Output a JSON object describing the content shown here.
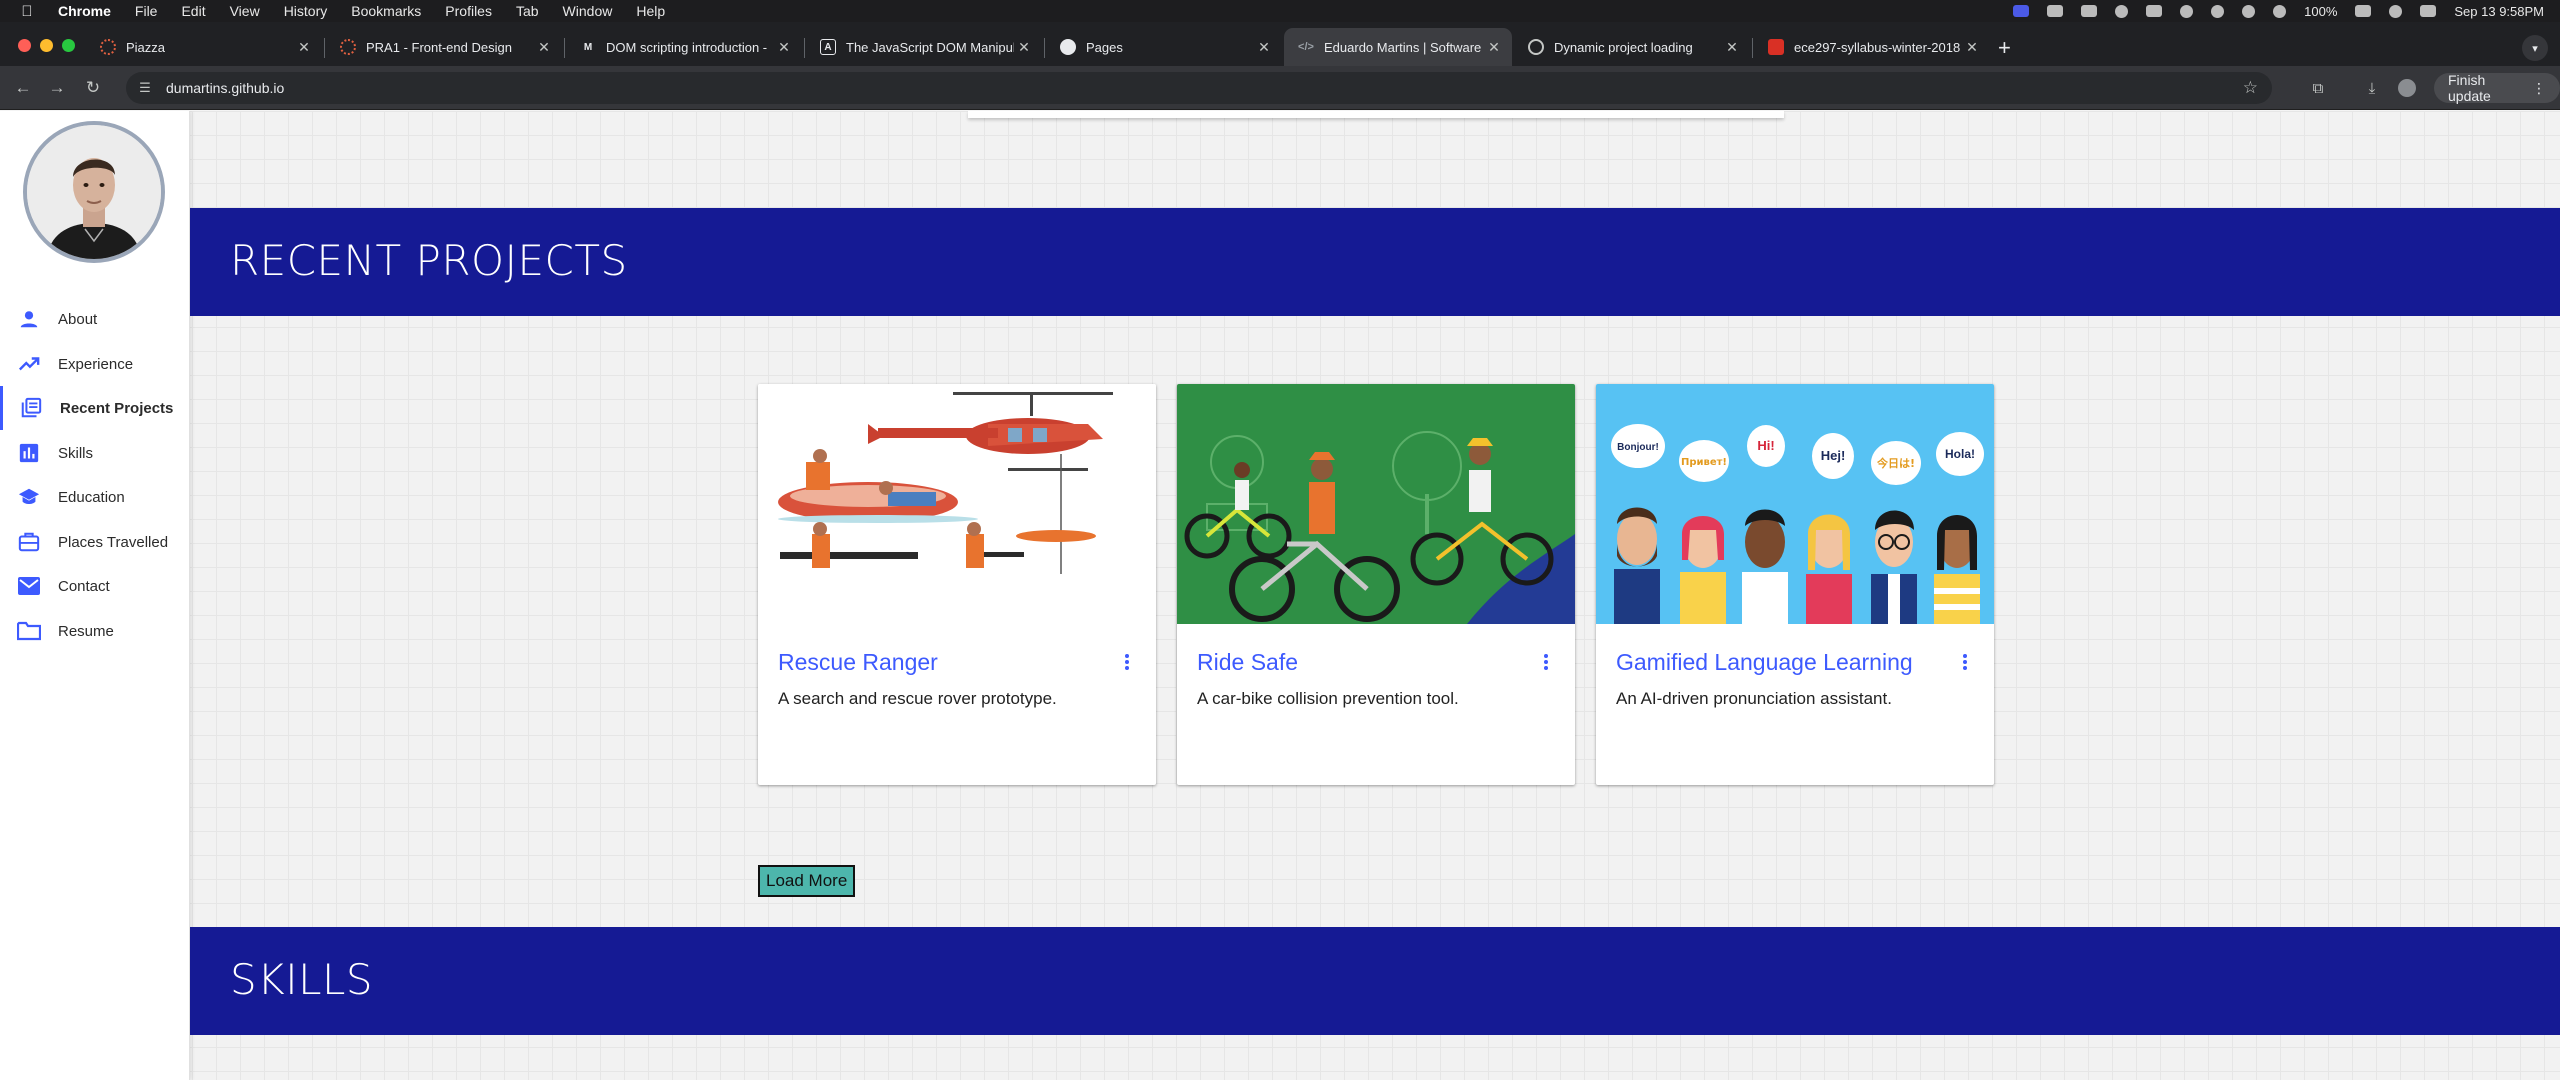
{
  "macos": {
    "app_name": "Chrome",
    "menu": [
      "Chrome",
      "File",
      "Edit",
      "View",
      "History",
      "Bookmarks",
      "Profiles",
      "Tab",
      "Window",
      "Help"
    ],
    "battery": "100%",
    "clock": "Sep 13  9:58PM"
  },
  "browser": {
    "tabs": [
      {
        "title": "Piazza",
        "icon": "piazza-icon"
      },
      {
        "title": "PRA1 - Front-end Design",
        "icon": "piazza-icon"
      },
      {
        "title": "DOM scripting introduction -",
        "icon": "mdn-icon"
      },
      {
        "title": "The JavaScript DOM Manipul",
        "icon": "freecodecamp-icon"
      },
      {
        "title": "Pages",
        "icon": "github-icon"
      },
      {
        "title": "Eduardo Martins | Software D",
        "icon": "code-icon"
      },
      {
        "title": "Dynamic project loading",
        "icon": "openai-icon"
      },
      {
        "title": "ece297-syllabus-winter-2018",
        "icon": "pdf-icon"
      }
    ],
    "active_tab": 5,
    "url": "dumartins.github.io",
    "finish_update_label": "Finish update"
  },
  "sidebar": {
    "items": [
      {
        "label": "About",
        "icon": "person-icon"
      },
      {
        "label": "Experience",
        "icon": "trending-up-icon"
      },
      {
        "label": "Recent Projects",
        "icon": "library-books-icon"
      },
      {
        "label": "Skills",
        "icon": "bar-chart-icon"
      },
      {
        "label": "Education",
        "icon": "school-icon"
      },
      {
        "label": "Places Travelled",
        "icon": "briefcase-icon"
      },
      {
        "label": "Contact",
        "icon": "mail-icon"
      },
      {
        "label": "Resume",
        "icon": "folder-icon"
      }
    ],
    "active_index": 2
  },
  "sections": {
    "projects_heading": "RECENT PROJECTS",
    "skills_heading": "SKILLS"
  },
  "projects": [
    {
      "title": "Rescue Ranger",
      "description": "A search and rescue rover prototype."
    },
    {
      "title": "Ride Safe",
      "description": "A car-bike collision prevention tool."
    },
    {
      "title": "Gamified Language Learning",
      "description": "An AI-driven pronunciation assistant."
    }
  ],
  "speech_bubbles": [
    "Bonjour!",
    "Привет!",
    "Hi!",
    "Hej!",
    "今日は!",
    "Hola!"
  ],
  "load_more_label": "Load More",
  "colors": {
    "banner": "#151a94",
    "accent": "#3d5afe",
    "load_more": "#4db6ac"
  }
}
